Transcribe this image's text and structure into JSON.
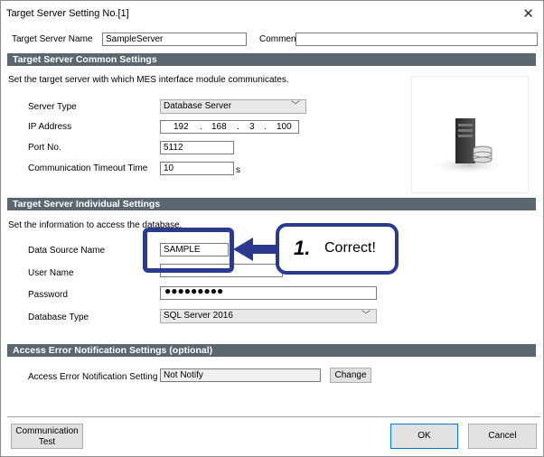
{
  "window": {
    "title": "Target Server Setting No.[1]",
    "close_icon": "close-icon"
  },
  "header": {
    "server_name_label": "Target Server Name",
    "server_name_value": "SampleServer",
    "comment_label": "Comment",
    "comment_value": ""
  },
  "common": {
    "section_title": "Target Server Common Settings",
    "description": "Set the target server with which MES interface module communicates.",
    "server_type_label": "Server Type",
    "server_type_value": "Database Server",
    "ip_label": "IP Address",
    "ip": [
      "192",
      "168",
      "3",
      "100"
    ],
    "port_label": "Port No.",
    "port_value": "5112",
    "timeout_label": "Communication Timeout Time",
    "timeout_value": "10",
    "timeout_unit": "s"
  },
  "individual": {
    "section_title": "Target Server Individual Settings",
    "description": "Set the information to access the database.",
    "datasource_label": "Data Source Name",
    "datasource_value": "SAMPLE",
    "username_label": "User Name",
    "username_value": "",
    "password_label": "Password",
    "password_value": "●●●●●●●●●",
    "dbtype_label": "Database Type",
    "dbtype_value": "SQL Server 2016"
  },
  "callout": {
    "number": "1.",
    "text": "Correct!",
    "color": "#2b3a8f"
  },
  "access": {
    "section_title": "Access Error Notification Settings (optional)",
    "setting_label": "Access Error Notification Setting",
    "setting_value": "Not Notify",
    "change_label": "Change"
  },
  "footer": {
    "comm_test_line1": "Communication",
    "comm_test_line2": "Test",
    "ok_label": "OK",
    "cancel_label": "Cancel"
  },
  "colors": {
    "section_bg": "#5b6670",
    "accent": "#2b3a8f"
  },
  "icons": {
    "server": "database-server-icon"
  }
}
